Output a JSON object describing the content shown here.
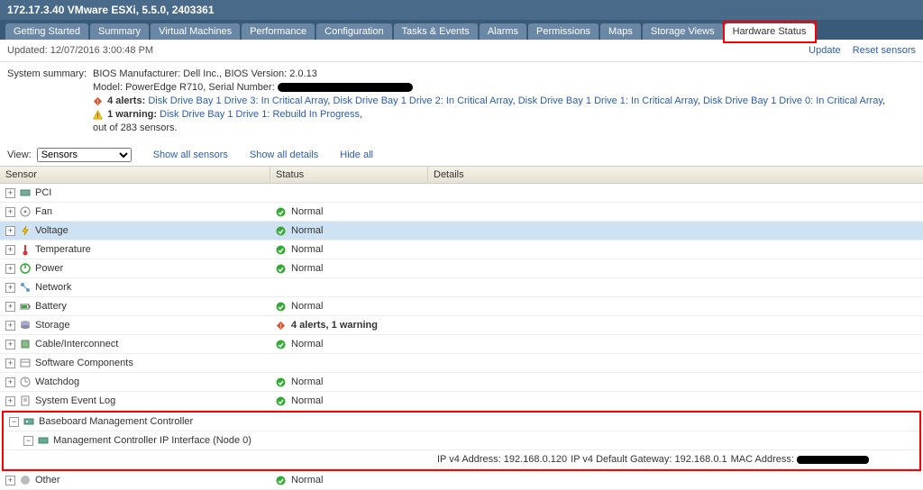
{
  "title": "172.17.3.40 VMware ESXi, 5.5.0, 2403361",
  "tabs": {
    "getting_started": "Getting Started",
    "summary": "Summary",
    "virtual_machines": "Virtual Machines",
    "performance": "Performance",
    "configuration": "Configuration",
    "tasks_events": "Tasks & Events",
    "alarms": "Alarms",
    "permissions": "Permissions",
    "maps": "Maps",
    "storage_views": "Storage Views",
    "hardware_status": "Hardware Status"
  },
  "updated": "Updated: 12/07/2016  3:00:48 PM",
  "links": {
    "update": "Update",
    "reset": "Reset sensors"
  },
  "summary_label": "System summary:",
  "summary": {
    "bios": "BIOS Manufacturer: Dell Inc., BIOS Version: 2.0.13",
    "model_prefix": "Model: PowerEdge R710, Serial Number:",
    "alerts_prefix": "4 alerts:",
    "alerts_links": [
      "Disk Drive Bay 1 Drive 3: In Critical Array",
      "Disk Drive Bay 1 Drive 2: In Critical Array",
      "Disk Drive Bay 1 Drive 1: In Critical Array",
      "Disk Drive Bay 1 Drive 0: In Critical Array"
    ],
    "warn_prefix": "1 warning:",
    "warn_link": "Disk Drive Bay 1 Drive 1: Rebuild In Progress",
    "out_of": "out of 283 sensors."
  },
  "view": {
    "label": "View:",
    "selected": "Sensors",
    "show_all_sensors": "Show all sensors",
    "show_all_details": "Show all details",
    "hide_all": "Hide all"
  },
  "columns": {
    "sensor": "Sensor",
    "status": "Status",
    "details": "Details"
  },
  "rows": {
    "pci": "PCI",
    "fan": "Fan",
    "voltage": "Voltage",
    "temperature": "Temperature",
    "power": "Power",
    "network": "Network",
    "battery": "Battery",
    "storage": "Storage",
    "cable": "Cable/Interconnect",
    "software": "Software Components",
    "watchdog": "Watchdog",
    "sel": "System Event Log",
    "bmc": "Baseboard Management Controller",
    "bmc_child": "Management Controller IP Interface (Node 0)",
    "other": "Other"
  },
  "status": {
    "normal": "Normal",
    "storage": "4 alerts, 1 warning"
  },
  "details": {
    "ipv4": "IP v4 Address: 192.168.0.120",
    "gw": "IP v4 Default Gateway: 192.168.0.1",
    "mac": "MAC Address:"
  }
}
